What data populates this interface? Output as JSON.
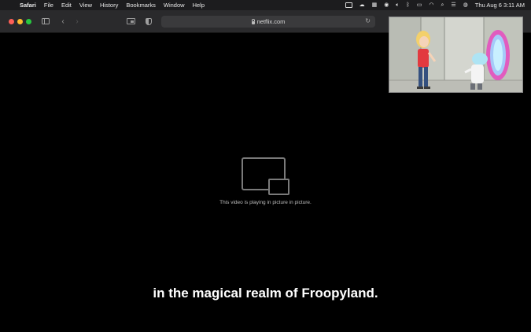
{
  "menubar": {
    "app_name": "Safari",
    "items": [
      "File",
      "Edit",
      "View",
      "History",
      "Bookmarks",
      "Window",
      "Help"
    ],
    "clock": "Thu Aug 6  3:11 AM"
  },
  "toolbar": {
    "url": "netflix.com"
  },
  "player": {
    "pip_message": "This video is playing in picture in picture.",
    "subtitle": "in the magical realm of Froopyland."
  },
  "colors": {
    "close": "#fe5f57",
    "minimize": "#febc2e",
    "maximize": "#28c840"
  }
}
